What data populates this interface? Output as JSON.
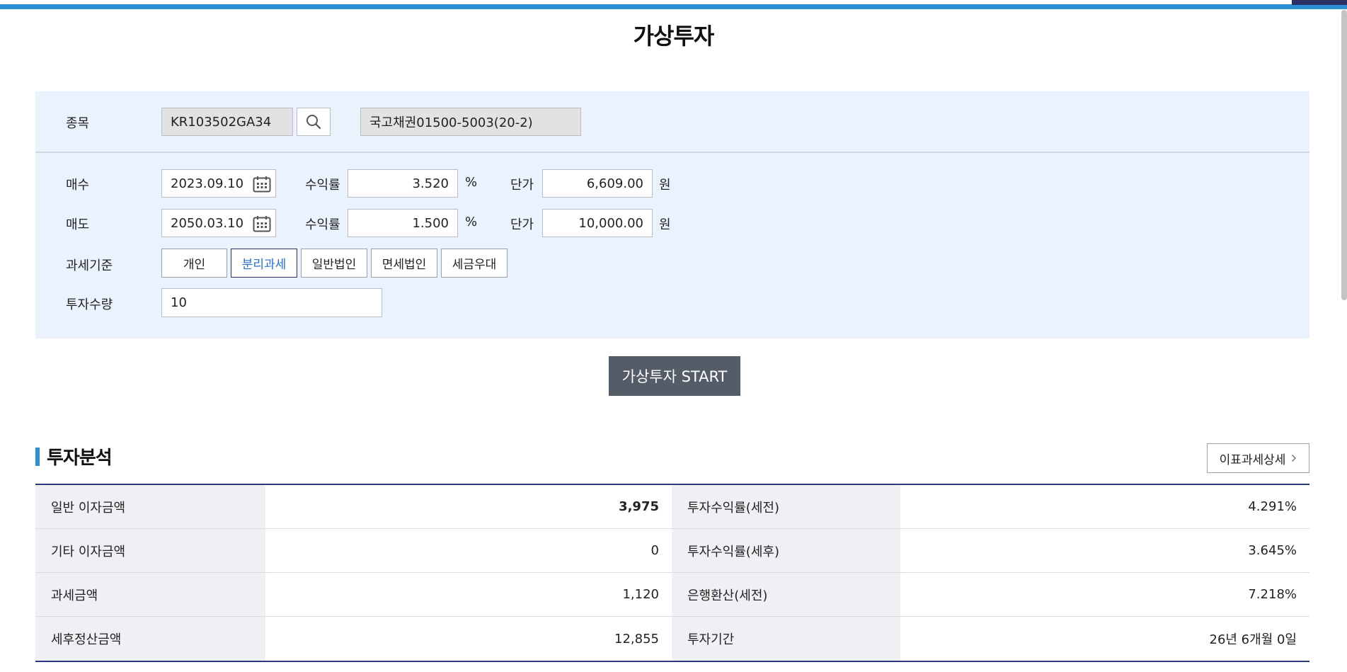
{
  "title": "가상투자",
  "form": {
    "item_label": "종목",
    "item_code": "KR103502GA34",
    "item_name": "국고채권01500-5003(20-2)",
    "buy": {
      "label": "매수",
      "date": "2023.09.10",
      "yield_label": "수익률",
      "yield": "3.520",
      "yield_unit": "%",
      "price_label": "단가",
      "price": "6,609.00",
      "price_unit": "원"
    },
    "sell": {
      "label": "매도",
      "date": "2050.03.10",
      "yield_label": "수익률",
      "yield": "1.500",
      "yield_unit": "%",
      "price_label": "단가",
      "price": "10,000.00",
      "price_unit": "원"
    },
    "tax_label": "과세기준",
    "tax_options": [
      "개인",
      "분리과세",
      "일반법인",
      "면세법인",
      "세금우대"
    ],
    "tax_selected": "분리과세",
    "quantity_label": "투자수량",
    "quantity": "10"
  },
  "start_button": "가상투자 START",
  "analysis": {
    "title": "투자분석",
    "detail_button": "이표과세상세",
    "rows": [
      {
        "label1": "일반 이자금액",
        "value1": "3,975",
        "label2": "투자수익률(세전)",
        "value2": "4.291%"
      },
      {
        "label1": "기타 이자금액",
        "value1": "0",
        "label2": "투자수익률(세후)",
        "value2": "3.645%"
      },
      {
        "label1": "과세금액",
        "value1": "1,120",
        "label2": "은행환산(세전)",
        "value2": "7.218%"
      },
      {
        "label1": "세후정산금액",
        "value1": "12,855",
        "label2": "투자기간",
        "value2": "26년 6개월 0일"
      }
    ]
  },
  "colors": {
    "accent_blue": "#2a8fd6",
    "navy": "#2b3a7c",
    "panel_bg": "#eaf3fd",
    "button_dark": "#545c67"
  }
}
